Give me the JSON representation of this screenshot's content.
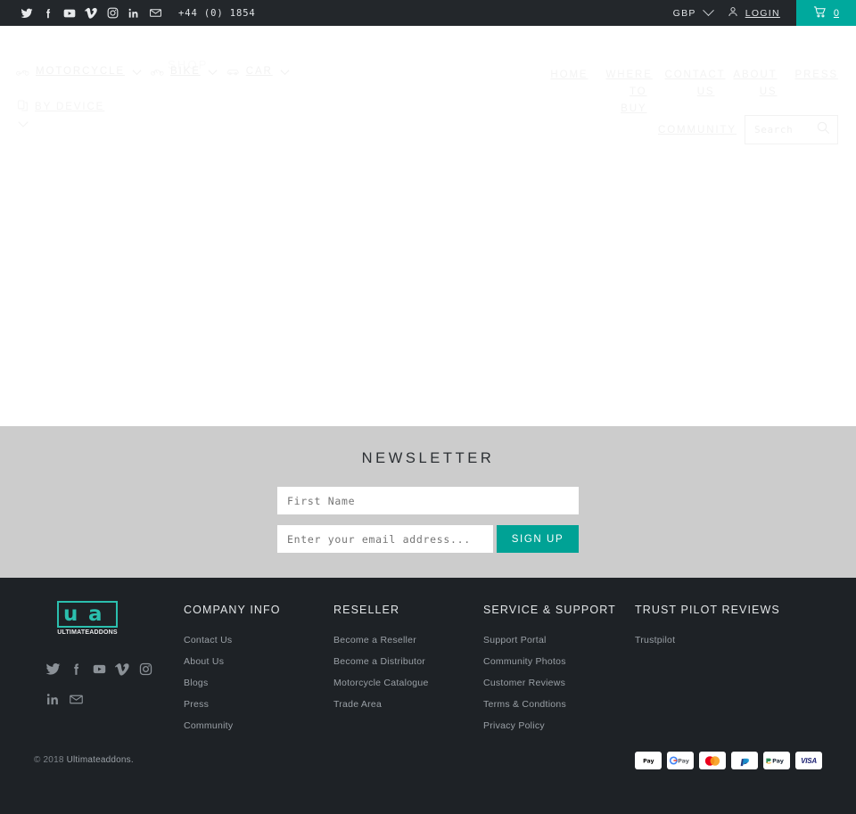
{
  "topbar": {
    "social": [
      {
        "name": "twitter-icon",
        "label": "Twitter"
      },
      {
        "name": "facebook-icon",
        "label": "Facebook"
      },
      {
        "name": "youtube-icon",
        "label": "YouTube"
      },
      {
        "name": "vimeo-icon",
        "label": "Vimeo"
      },
      {
        "name": "instagram-icon",
        "label": "Instagram"
      },
      {
        "name": "linkedin-icon",
        "label": "LinkedIn"
      },
      {
        "name": "email-icon",
        "label": "Email"
      }
    ],
    "phone": "+44 (0) 1854",
    "currency": "GBP",
    "login": "LOGIN",
    "cart_count": "0",
    "colors": {
      "bar_bg": "#23272b",
      "cart_bg": "#00a99d"
    }
  },
  "header": {
    "shop_label": "SHOP",
    "primary_nav": [
      {
        "label": "MOTORCYCLE",
        "icon": "motorcycle-icon"
      },
      {
        "label": "BIKE",
        "icon": "bicycle-icon"
      },
      {
        "label": "CAR",
        "icon": "car-icon"
      }
    ],
    "by_device": "BY DEVICE",
    "secondary_nav": [
      {
        "label": "HOME"
      },
      {
        "label": "WHERE TO BUY"
      },
      {
        "label": "CONTACT US"
      },
      {
        "label": "ABOUT US"
      },
      {
        "label": "PRESS"
      }
    ],
    "community": "COMMUNITY",
    "search": {
      "placeholder": "Search",
      "value": "",
      "icon": "search-icon"
    }
  },
  "newsletter": {
    "title": "NEWSLETTER",
    "first_name": {
      "placeholder": "First Name",
      "value": ""
    },
    "email": {
      "placeholder": "Enter your email address...",
      "value": ""
    },
    "signup_label": "SIGN UP",
    "colors": {
      "bg": "#cccccc",
      "button": "#00a295"
    }
  },
  "footer": {
    "logo": {
      "mark_left": "u",
      "mark_right": "a",
      "wordmark": "ULTIMATEADDONS",
      "color": "#2bbfae"
    },
    "social": [
      {
        "name": "twitter-icon",
        "label": "Twitter"
      },
      {
        "name": "facebook-icon",
        "label": "Facebook"
      },
      {
        "name": "youtube-icon",
        "label": "YouTube"
      },
      {
        "name": "vimeo-icon",
        "label": "Vimeo"
      },
      {
        "name": "instagram-icon",
        "label": "Instagram"
      },
      {
        "name": "linkedin-icon",
        "label": "LinkedIn"
      },
      {
        "name": "email-icon",
        "label": "Email"
      }
    ],
    "columns": [
      {
        "heading": "COMPANY INFO",
        "links": [
          "Contact Us",
          "About Us",
          "Blogs",
          "Press",
          "Community"
        ]
      },
      {
        "heading": "RESELLER",
        "links": [
          "Become a Reseller",
          "Become a Distributor",
          "Motorcycle Catalogue",
          "Trade Area"
        ]
      },
      {
        "heading": "SERVICE & SUPPORT",
        "links": [
          "Support Portal",
          "Community Photos",
          "Customer Reviews",
          "Terms & Condtions",
          "Privacy Policy"
        ]
      },
      {
        "heading": "TRUST PILOT REVIEWS",
        "links": [
          "Trustpilot"
        ]
      }
    ],
    "copyright_prefix": "© 2018 ",
    "copyright_brand": "Ultimateaddons.",
    "payments": [
      {
        "name": "apple-pay-icon",
        "label": "Pay"
      },
      {
        "name": "google-pay-icon",
        "label": "Pay"
      },
      {
        "name": "mastercard-icon",
        "label": ""
      },
      {
        "name": "paypal-icon",
        "label": "P"
      },
      {
        "name": "amazon-pay-icon",
        "label": "Pay"
      },
      {
        "name": "visa-icon",
        "label": "VISA"
      }
    ]
  }
}
